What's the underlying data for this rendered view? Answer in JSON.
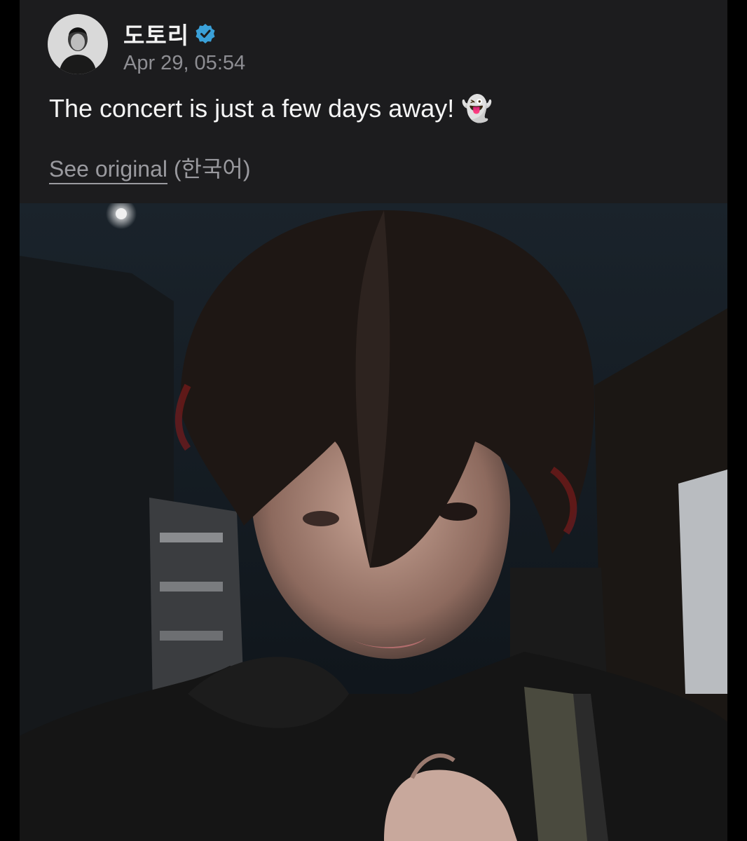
{
  "post": {
    "author_name": "도토리",
    "verified": true,
    "timestamp": "Apr 29, 05:54",
    "text": "The concert is just a few days away! 👻",
    "translation": {
      "link_label": "See original",
      "language": "(한국어)"
    },
    "avatar_icon": "user-avatar-photo",
    "verified_icon": "verified-badge-icon",
    "photo": "selfie-photo-night"
  },
  "colors": {
    "background": "#000000",
    "card": "#1c1c1e",
    "primary_text": "#f5f5f5",
    "secondary_text": "#8e8e93",
    "verified_badge": "#3aa0d8"
  }
}
